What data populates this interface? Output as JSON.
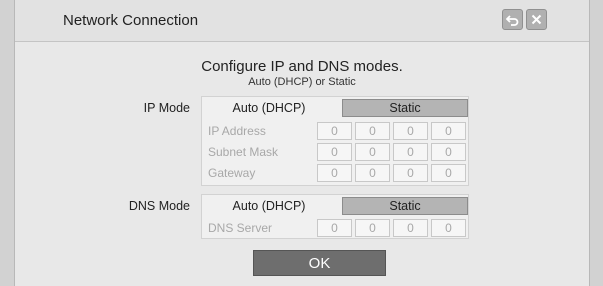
{
  "dialog": {
    "title": "Network Connection",
    "back_icon": "back-arrow-icon",
    "close_icon": "close-icon"
  },
  "heading": "Configure IP and DNS modes.",
  "subheading": "Auto (DHCP) or Static",
  "ip": {
    "label": "IP Mode",
    "auto_label": "Auto (DHCP)",
    "static_label": "Static",
    "selected": "Static",
    "fields": [
      {
        "label": "IP Address",
        "octets": [
          "0",
          "0",
          "0",
          "0"
        ]
      },
      {
        "label": "Subnet Mask",
        "octets": [
          "0",
          "0",
          "0",
          "0"
        ]
      },
      {
        "label": "Gateway",
        "octets": [
          "0",
          "0",
          "0",
          "0"
        ]
      }
    ]
  },
  "dns": {
    "label": "DNS Mode",
    "auto_label": "Auto (DHCP)",
    "static_label": "Static",
    "selected": "Static",
    "fields": [
      {
        "label": "DNS Server",
        "octets": [
          "0",
          "0",
          "0",
          "0"
        ]
      }
    ]
  },
  "ok_label": "OK",
  "colors": {
    "selected_option": "#b4b4b4",
    "ok_button": "#6e6e6e",
    "disabled_text": "#a8a8a8"
  }
}
